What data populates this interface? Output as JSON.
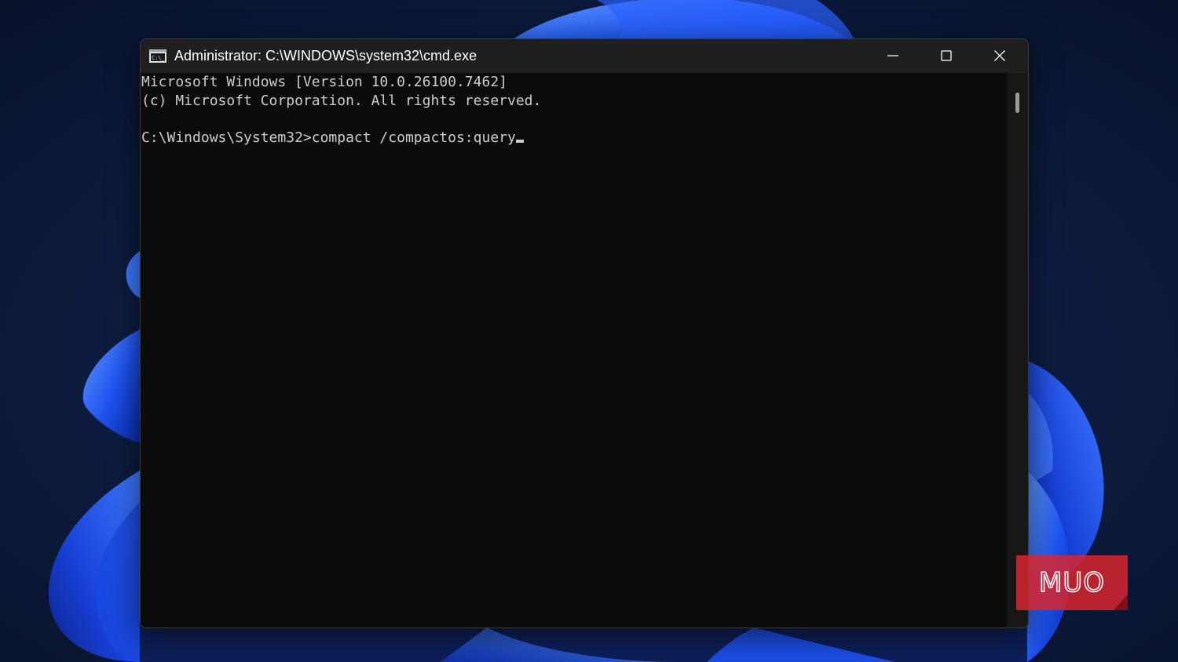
{
  "window": {
    "title": "Administrator: C:\\WINDOWS\\system32\\cmd.exe",
    "icon": "cmd-icon",
    "icon_text": "C:\\_",
    "controls": {
      "minimize": "minimize-icon",
      "maximize": "maximize-icon",
      "close": "close-icon"
    }
  },
  "console": {
    "lines": [
      "Microsoft Windows [Version 10.0.26100.7462]",
      "(c) Microsoft Corporation. All rights reserved.",
      "",
      "C:\\Windows\\System32>compact /compactos:query"
    ],
    "foreground": "#cccccc",
    "background": "#0c0c0c"
  },
  "watermark": {
    "text": "MUO",
    "color": "#e0303a"
  },
  "colors": {
    "titlebar": "#1f1f1f",
    "wallpaper_dark": "#0b1733",
    "wallpaper_accent": "#1e5cff"
  }
}
